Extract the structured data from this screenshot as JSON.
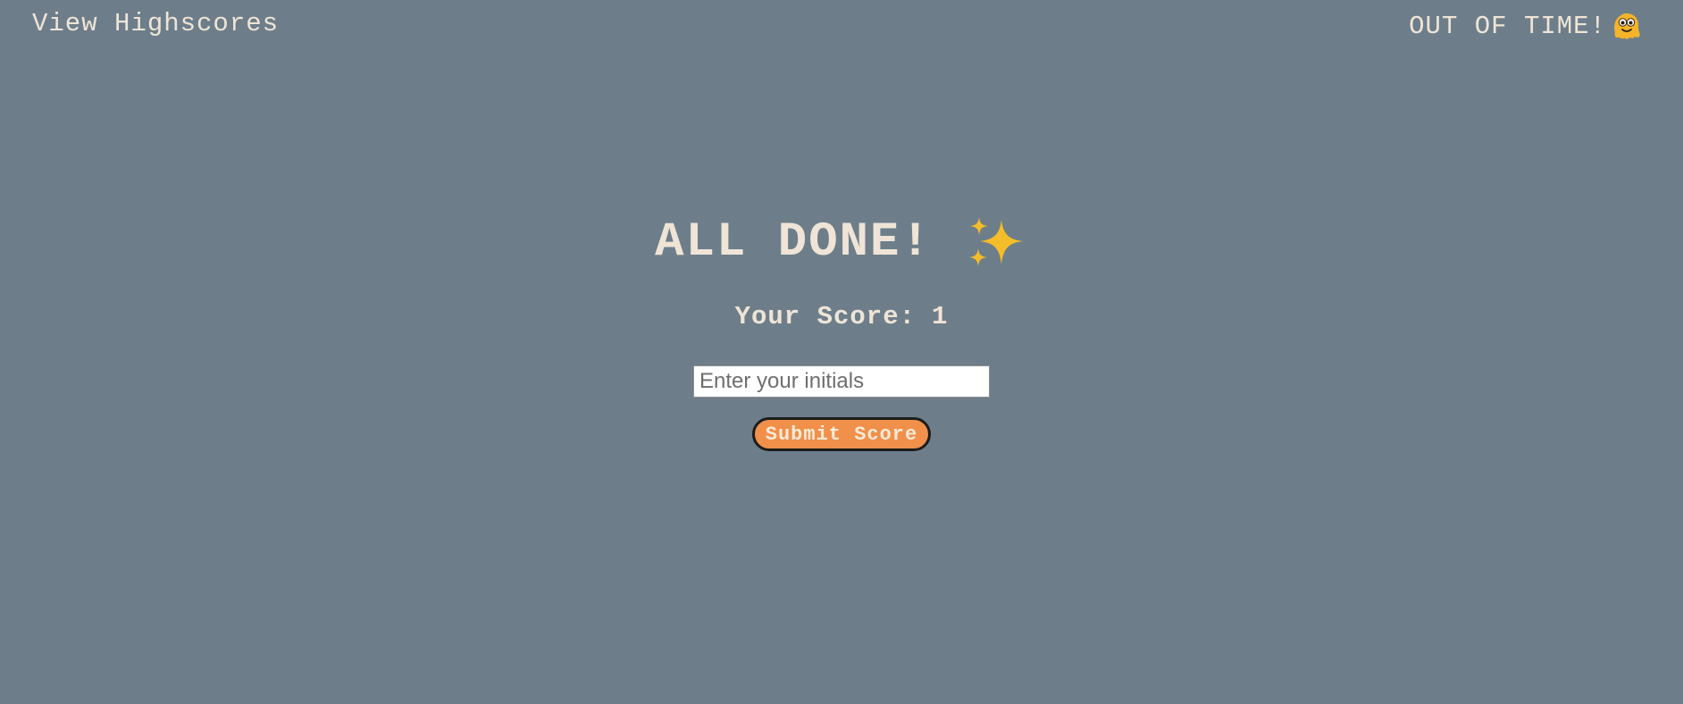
{
  "header": {
    "highscores_link": "View Highscores",
    "timer_text": "OUT OF TIME!",
    "timer_icon": "worried-face-icon"
  },
  "result": {
    "title": "ALL DONE!",
    "title_icon": "sparkles-icon",
    "score_label": "Your Score:",
    "score_value": "1"
  },
  "form": {
    "initials_placeholder": "Enter your initials",
    "initials_value": "",
    "submit_label": "Submit Score"
  },
  "colors": {
    "background": "#6d7e8a",
    "text": "#efe4d6",
    "button": "#f0904b",
    "sparkles": "#f6bd2a"
  }
}
